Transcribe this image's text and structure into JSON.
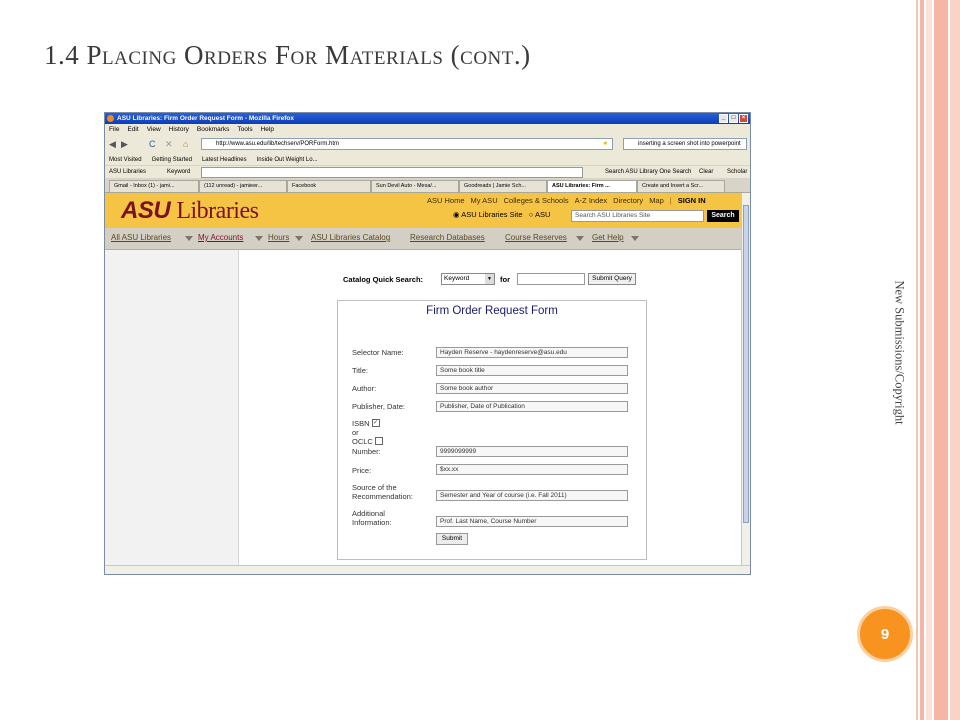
{
  "slide": {
    "title": "1.4 Placing Orders For Materials (cont.)",
    "side_caption": "New Submissions/Copyright",
    "page_number": "9"
  },
  "browser": {
    "window_title": "ASU Libraries: Firm Order Request Form - Mozilla Firefox",
    "menu": [
      "File",
      "Edit",
      "View",
      "History",
      "Bookmarks",
      "Tools",
      "Help"
    ],
    "url": "http://www.asu.edu/lib/techserv/PORForm.htm",
    "search_value": "inserting a screen shot into powerpoint",
    "bookmarks": [
      "Most Visited",
      "Getting Started",
      "Latest Headlines",
      "Inside Out Weight Lo..."
    ],
    "asu_toolbar": {
      "brand": "ASU Libraries",
      "keyword_label": "Keyword",
      "search_label": "Search ASU Library One Search",
      "clear": "Clear",
      "scholar": "Scholar"
    },
    "tabs": [
      "Gmail - Inbox (1) - jami...",
      "(112 unread) - jamieer...",
      "Facebook",
      "Sun Devil Auto - Mesa/...",
      "Goodreads | Jamie Sch...",
      "ASU Libraries: Firm ...",
      "Create and Insert a Scr..."
    ]
  },
  "asu": {
    "logo_bold": "ASU",
    "logo_rest": "Libraries",
    "top_links": [
      "ASU Home",
      "My ASU",
      "Colleges & Schools",
      "A-Z Index",
      "Directory",
      "Map"
    ],
    "sign_in": "SIGN IN",
    "radio_site": "ASU Libraries Site",
    "radio_asu": "ASU",
    "search_placeholder": "Search ASU Libraries Site",
    "search_button": "Search",
    "nav": [
      "All ASU Libraries",
      "My Accounts",
      "Hours",
      "ASU Libraries Catalog",
      "Research Databases",
      "Course Reserves",
      "Get Help"
    ]
  },
  "catalog": {
    "label": "Catalog Quick Search:",
    "select_value": "Keyword",
    "for_label": "for",
    "button": "Submit Query"
  },
  "form": {
    "title": "Firm Order Request Form",
    "fields": {
      "selector": {
        "label": "Selector Name:",
        "value": "Hayden Reserve - haydenreserve@asu.edu"
      },
      "title": {
        "label": "Title:",
        "value": "Some book title"
      },
      "author": {
        "label": "Author:",
        "value": "Some book author"
      },
      "publisher": {
        "label": "Publisher, Date:",
        "value": "Publisher, Date of Publication"
      },
      "isbn": {
        "label_isbn": "ISBN",
        "label_or": "or",
        "label_oclc": "OCLC",
        "label_number": "Number:",
        "value": "9999099999",
        "isbn_checked": true,
        "oclc_checked": false
      },
      "price": {
        "label": "Price:",
        "value": "$xx.xx"
      },
      "source": {
        "label_line1": "Source of the",
        "label_line2": "Recommendation:",
        "value": "Semester and Year of course (i.e. Fall 2011)"
      },
      "additional": {
        "label_line1": "Additional",
        "label_line2": "Information:",
        "value": "Prof. Last Name, Course Number"
      }
    },
    "submit": "Submit"
  },
  "colors": {
    "asu_gold": "#f5c445",
    "asu_maroon": "#7b1123",
    "badge_orange": "#f7931e",
    "stripe_pink": "#f4b7a6"
  }
}
